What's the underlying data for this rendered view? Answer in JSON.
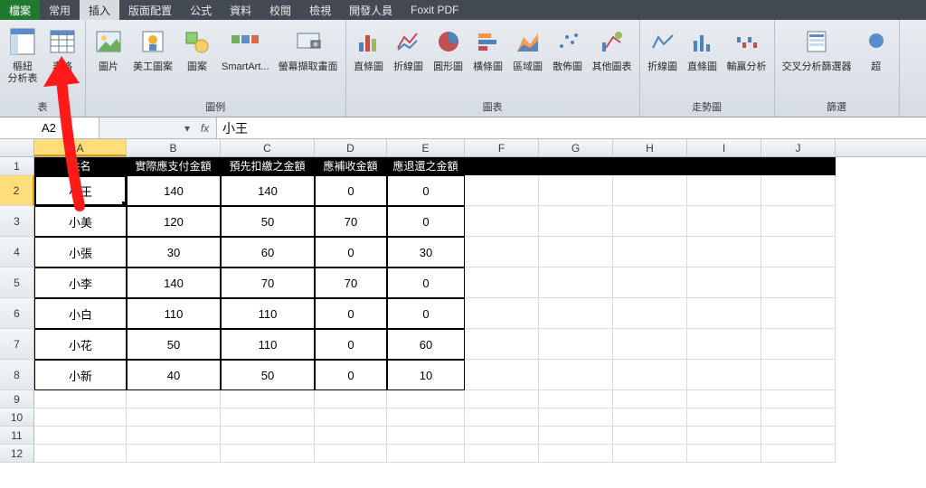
{
  "tabs": {
    "file": "檔案",
    "items": [
      "常用",
      "插入",
      "版面配置",
      "公式",
      "資料",
      "校閱",
      "檢視",
      "開發人員",
      "Foxit PDF"
    ],
    "activeIndex": 1
  },
  "ribbon": {
    "groups": [
      {
        "label": "表",
        "buttons": [
          {
            "name": "pivot-table",
            "label": "樞紐\n分析表"
          },
          {
            "name": "table",
            "label": "表格"
          }
        ]
      },
      {
        "label": "圖例",
        "buttons": [
          {
            "name": "picture",
            "label": "圖片"
          },
          {
            "name": "clipart",
            "label": "美工圖案"
          },
          {
            "name": "shapes",
            "label": "圖案"
          },
          {
            "name": "smartart",
            "label": "SmartArt..."
          },
          {
            "name": "screenshot",
            "label": "螢幕擷取畫面"
          }
        ]
      },
      {
        "label": "圖表",
        "buttons": [
          {
            "name": "bar-chart",
            "label": "直條圖"
          },
          {
            "name": "line-chart",
            "label": "折線圖"
          },
          {
            "name": "pie-chart",
            "label": "圓形圖"
          },
          {
            "name": "hbar-chart",
            "label": "橫條圖"
          },
          {
            "name": "area-chart",
            "label": "區域圖"
          },
          {
            "name": "scatter-chart",
            "label": "散佈圖"
          },
          {
            "name": "other-chart",
            "label": "其他圖表"
          }
        ]
      },
      {
        "label": "走勢圖",
        "buttons": [
          {
            "name": "spark-line",
            "label": "折線圖"
          },
          {
            "name": "spark-col",
            "label": "直條圖"
          },
          {
            "name": "spark-wl",
            "label": "輸贏分析"
          }
        ]
      },
      {
        "label": "篩選",
        "buttons": [
          {
            "name": "slicer",
            "label": "交叉分析篩選器"
          },
          {
            "name": "timeline",
            "label": "超"
          }
        ]
      }
    ]
  },
  "formula_bar": {
    "name_box": "A2",
    "fx": "fx",
    "value": "小王"
  },
  "columns": [
    "A",
    "B",
    "C",
    "D",
    "E",
    "F",
    "G",
    "H",
    "I",
    "J"
  ],
  "selected_col": 0,
  "selected_row": 2,
  "chart_data": {
    "type": "table",
    "headers": [
      "姓名",
      "實際應支付金額",
      "預先扣繳之金額",
      "應補收金額",
      "應退還之金額"
    ],
    "rows": [
      [
        "小王",
        140,
        140,
        0,
        0
      ],
      [
        "小美",
        120,
        50,
        70,
        0
      ],
      [
        "小張",
        30,
        60,
        0,
        30
      ],
      [
        "小李",
        140,
        70,
        70,
        0
      ],
      [
        "小白",
        110,
        110,
        0,
        0
      ],
      [
        "小花",
        50,
        110,
        0,
        60
      ],
      [
        "小新",
        40,
        50,
        0,
        10
      ]
    ]
  },
  "row_numbers": [
    1,
    2,
    3,
    4,
    5,
    6,
    7,
    8,
    9,
    10,
    11,
    12
  ]
}
